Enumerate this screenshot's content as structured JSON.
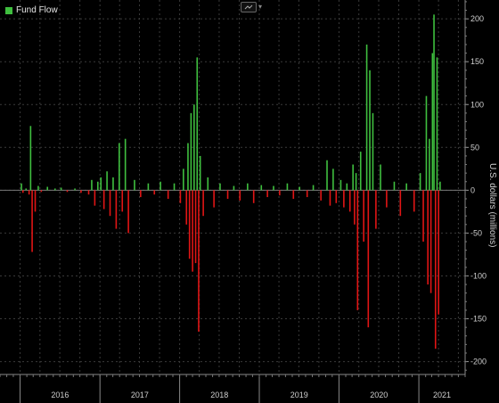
{
  "legend": {
    "label": "Fund Flow",
    "color": "#3fbf3f"
  },
  "toolbar": {
    "icon": "chart-settings-icon",
    "caret": "▾"
  },
  "colors": {
    "positive": "#3fbf3f",
    "negative": "#e01515",
    "grid": "#3a3a3a",
    "background": "#000000"
  },
  "chart_data": {
    "type": "bar",
    "series_name": "Fund Flow",
    "ylabel": "U.S. dollars (millions)",
    "ylim": [
      -215,
      222
    ],
    "yticks": [
      200,
      150,
      100,
      50,
      0,
      -50,
      -100,
      -150,
      -200
    ],
    "year_ticks": [
      "2016",
      "2017",
      "2018",
      "2019",
      "2020",
      "2021"
    ],
    "x_range": [
      "2015-10",
      "2021-08"
    ],
    "grid": true,
    "legend_position": "top-left",
    "values_by_week": [
      [
        "2016-01-04",
        8
      ],
      [
        "2016-01-11",
        -3
      ],
      [
        "2016-01-25",
        2
      ],
      [
        "2016-02-08",
        -5
      ],
      [
        "2016-02-15",
        75
      ],
      [
        "2016-02-22",
        -72
      ],
      [
        "2016-03-07",
        -25
      ],
      [
        "2016-03-21",
        5
      ],
      [
        "2016-04-04",
        -2
      ],
      [
        "2016-05-02",
        4
      ],
      [
        "2016-06-06",
        2
      ],
      [
        "2016-07-04",
        3
      ],
      [
        "2016-08-01",
        -2
      ],
      [
        "2016-09-05",
        2
      ],
      [
        "2016-10-03",
        -3
      ],
      [
        "2016-11-07",
        -5
      ],
      [
        "2016-11-21",
        12
      ],
      [
        "2016-12-05",
        -18
      ],
      [
        "2016-12-19",
        10
      ],
      [
        "2017-01-02",
        15
      ],
      [
        "2017-01-16",
        -22
      ],
      [
        "2017-01-30",
        22
      ],
      [
        "2017-02-13",
        -30
      ],
      [
        "2017-02-27",
        15
      ],
      [
        "2017-03-13",
        -45
      ],
      [
        "2017-03-27",
        55
      ],
      [
        "2017-04-10",
        -25
      ],
      [
        "2017-04-24",
        60
      ],
      [
        "2017-05-08",
        -50
      ],
      [
        "2017-06-05",
        12
      ],
      [
        "2017-07-03",
        -8
      ],
      [
        "2017-08-07",
        8
      ],
      [
        "2017-09-04",
        -5
      ],
      [
        "2017-10-02",
        10
      ],
      [
        "2017-11-06",
        -10
      ],
      [
        "2017-12-04",
        8
      ],
      [
        "2018-01-01",
        -15
      ],
      [
        "2018-01-15",
        25
      ],
      [
        "2018-01-29",
        -40
      ],
      [
        "2018-02-05",
        55
      ],
      [
        "2018-02-12",
        -80
      ],
      [
        "2018-02-19",
        90
      ],
      [
        "2018-02-26",
        -95
      ],
      [
        "2018-03-05",
        100
      ],
      [
        "2018-03-12",
        -85
      ],
      [
        "2018-03-19",
        155
      ],
      [
        "2018-03-26",
        -165
      ],
      [
        "2018-04-02",
        40
      ],
      [
        "2018-04-16",
        -30
      ],
      [
        "2018-05-07",
        15
      ],
      [
        "2018-06-04",
        -20
      ],
      [
        "2018-07-02",
        8
      ],
      [
        "2018-08-06",
        -10
      ],
      [
        "2018-09-03",
        5
      ],
      [
        "2018-10-01",
        -12
      ],
      [
        "2018-11-05",
        8
      ],
      [
        "2018-12-03",
        -15
      ],
      [
        "2019-01-07",
        6
      ],
      [
        "2019-02-04",
        -8
      ],
      [
        "2019-03-04",
        5
      ],
      [
        "2019-04-01",
        -6
      ],
      [
        "2019-05-06",
        8
      ],
      [
        "2019-06-03",
        -10
      ],
      [
        "2019-07-01",
        4
      ],
      [
        "2019-08-05",
        -8
      ],
      [
        "2019-09-02",
        6
      ],
      [
        "2019-10-07",
        -12
      ],
      [
        "2019-11-04",
        35
      ],
      [
        "2019-11-18",
        -18
      ],
      [
        "2019-12-02",
        25
      ],
      [
        "2019-12-16",
        -15
      ],
      [
        "2020-01-06",
        12
      ],
      [
        "2020-01-20",
        -20
      ],
      [
        "2020-02-03",
        8
      ],
      [
        "2020-02-17",
        -25
      ],
      [
        "2020-03-02",
        30
      ],
      [
        "2020-03-09",
        -40
      ],
      [
        "2020-03-16",
        20
      ],
      [
        "2020-03-23",
        -140
      ],
      [
        "2020-04-06",
        45
      ],
      [
        "2020-04-20",
        -60
      ],
      [
        "2020-05-04",
        170
      ],
      [
        "2020-05-11",
        -160
      ],
      [
        "2020-05-18",
        140
      ],
      [
        "2020-06-01",
        90
      ],
      [
        "2020-06-15",
        -45
      ],
      [
        "2020-07-06",
        30
      ],
      [
        "2020-08-03",
        -20
      ],
      [
        "2020-09-07",
        10
      ],
      [
        "2020-10-05",
        -30
      ],
      [
        "2020-11-02",
        8
      ],
      [
        "2020-12-07",
        -25
      ],
      [
        "2021-01-04",
        20
      ],
      [
        "2021-01-18",
        -60
      ],
      [
        "2021-02-01",
        110
      ],
      [
        "2021-02-08",
        -110
      ],
      [
        "2021-02-15",
        60
      ],
      [
        "2021-02-22",
        -120
      ],
      [
        "2021-03-01",
        160
      ],
      [
        "2021-03-08",
        205
      ],
      [
        "2021-03-15",
        -185
      ],
      [
        "2021-03-22",
        155
      ],
      [
        "2021-03-29",
        -145
      ],
      [
        "2021-04-05",
        10
      ]
    ]
  }
}
